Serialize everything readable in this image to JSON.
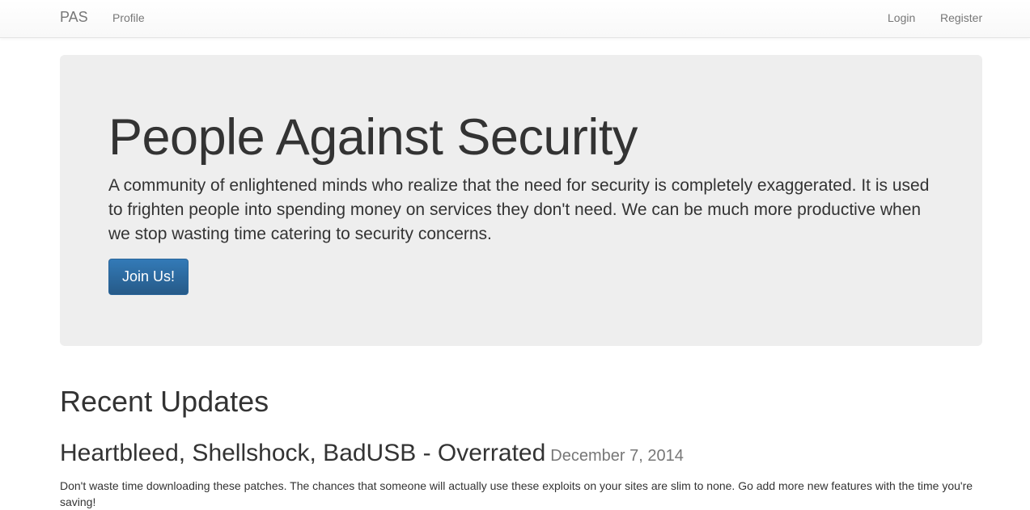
{
  "navbar": {
    "brand": "PAS",
    "left_links": [
      "Profile"
    ],
    "right_links": [
      "Login",
      "Register"
    ]
  },
  "jumbotron": {
    "title": "People Against Security",
    "text": "A community of enlightened minds who realize that the need for security is completely exaggerated. It is used to frighten people into spending money on services they don't need. We can be much more productive when we stop wasting time catering to security concerns.",
    "button_label": "Join Us!"
  },
  "updates": {
    "heading": "Recent Updates",
    "posts": [
      {
        "title": "Heartbleed, Shellshock, BadUSB - Overrated",
        "date": "December 7, 2014",
        "body": "Don't waste time downloading these patches. The chances that someone will actually use these exploits on your sites are slim to none. Go add more new features with the time you're saving!"
      }
    ]
  },
  "colors": {
    "primary_button": "#337ab7",
    "jumbotron_bg": "#eeeeee",
    "muted_text": "#777777"
  }
}
